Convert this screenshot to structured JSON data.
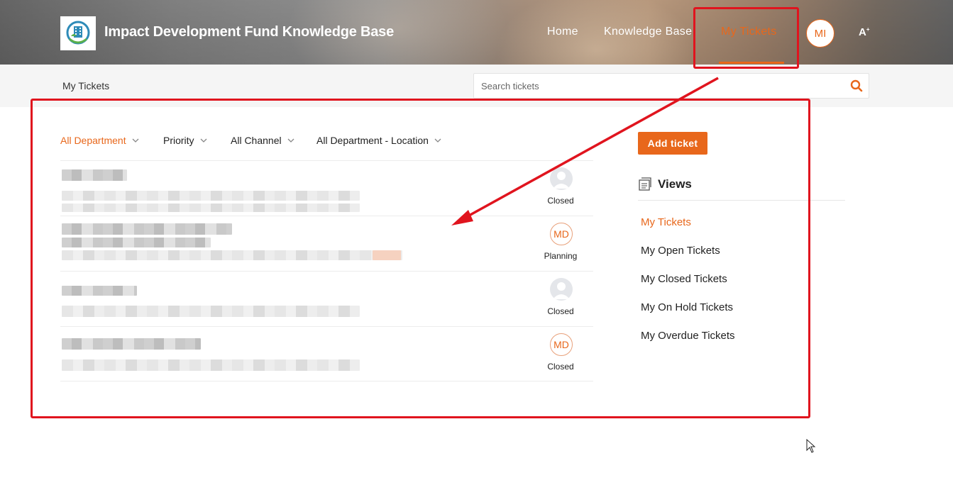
{
  "header": {
    "site_title": "Impact Development Fund Knowledge Base",
    "nav": {
      "home": "Home",
      "knowledge_base": "Knowledge Base",
      "my_tickets": "My Tickets"
    },
    "user_initials": "MI",
    "font_toggle": "A"
  },
  "subbar": {
    "breadcrumb": "My Tickets",
    "search_placeholder": "Search tickets"
  },
  "filters": {
    "department": "All Department",
    "priority": "Priority",
    "channel": "All Channel",
    "location": "All Department - Location"
  },
  "tickets": [
    {
      "status": "Closed",
      "assignee": ""
    },
    {
      "status": "Planning",
      "assignee": "MD"
    },
    {
      "status": "Closed",
      "assignee": ""
    },
    {
      "status": "Closed",
      "assignee": "MD"
    }
  ],
  "sidebar": {
    "add_ticket": "Add ticket",
    "views_title": "Views",
    "views": [
      "My Tickets",
      "My Open Tickets",
      "My Closed Tickets",
      "My On Hold Tickets",
      "My Overdue Tickets"
    ]
  },
  "colors": {
    "accent": "#e8671b",
    "annotation": "#e0141e"
  }
}
